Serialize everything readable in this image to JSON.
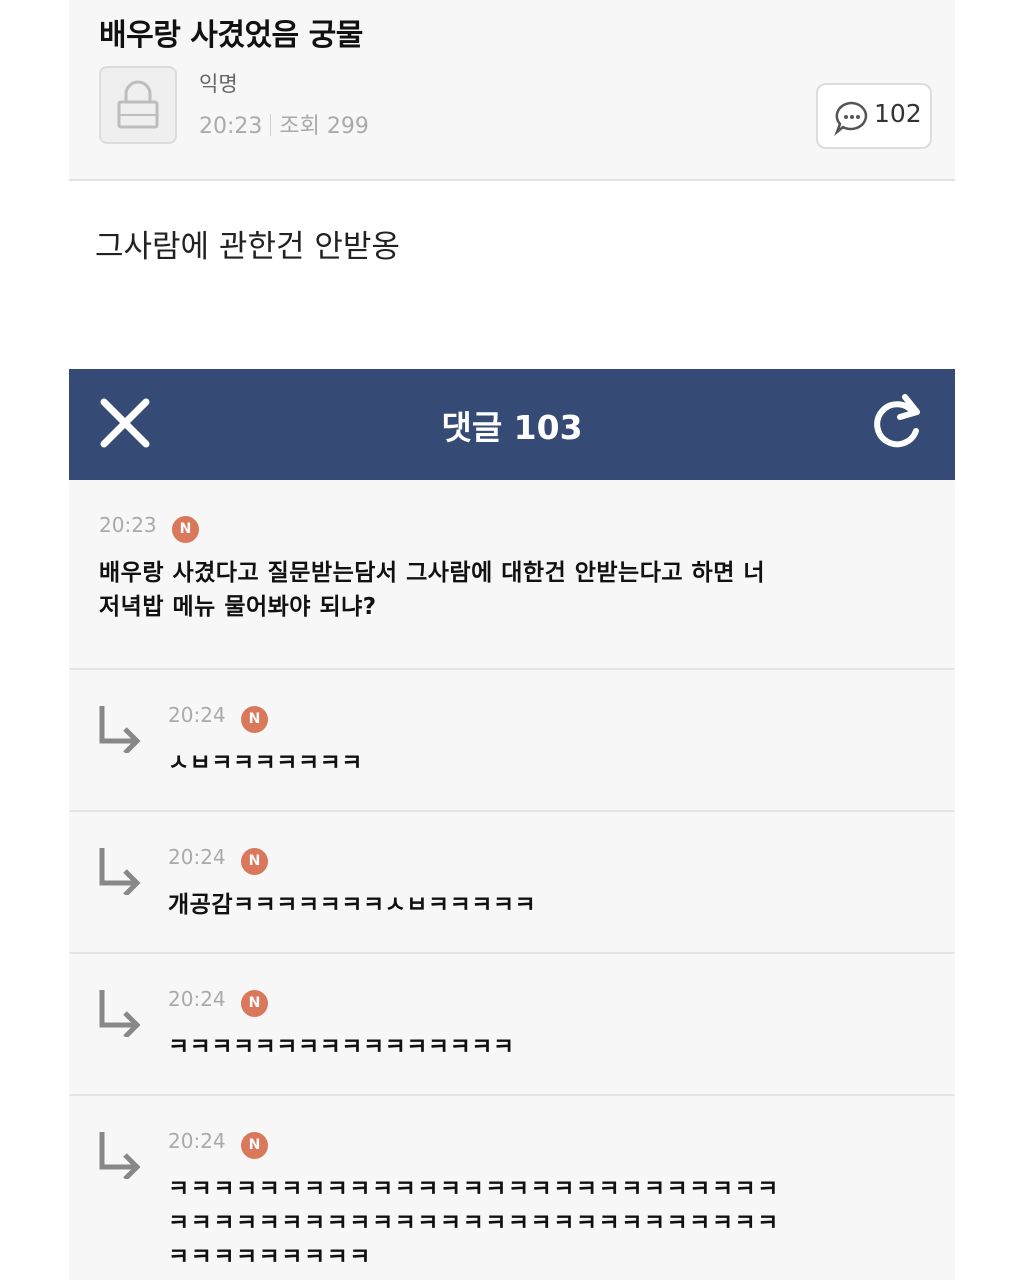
{
  "post": {
    "title": "배우랑 사겼었음 궁물",
    "author": "익명",
    "time": "20:23",
    "views_label": "조회 299",
    "comment_count": "102",
    "body": "그사람에 관한건 안받옹"
  },
  "comments_header": {
    "title": "댓글 103"
  },
  "comments": [
    {
      "time": "20:23",
      "badge": "N",
      "text_line1": "배우랑 사겼다고 질문받는담서 그사람에 대한건 안받는다고 하면 너",
      "text_line2": "저녁밥 메뉴 물어봐야 되냐?"
    },
    {
      "time": "20:24",
      "badge": "N",
      "text": "ㅅㅂㅋㅋㅋㅋㅋㅋㅋ"
    },
    {
      "time": "20:24",
      "badge": "N",
      "text": "개공감ㅋㅋㅋㅋㅋㅋㅋㅅㅂㅋㅋㅋㅋㅋ"
    },
    {
      "time": "20:24",
      "badge": "N",
      "text": "ㅋㅋㅋㅋㅋㅋㅋㅋㅋㅋㅋㅋㅋㅋㅋㅋ"
    },
    {
      "time": "20:24",
      "badge": "N",
      "text_line1": "ㅋㅋㅋㅋㅋㅋㅋㅋㅋㅋㅋㅋㅋㅋㅋㅋㅋㅋㅋㅋㅋㅋㅋㅋㅋㅋㅋ",
      "text_line2": "ㅋㅋㅋㅋㅋㅋㅋㅋㅋㅋㅋㅋㅋㅋㅋㅋㅋㅋㅋㅋㅋㅋㅋㅋㅋㅋㅋ",
      "text_line3": "ㅋㅋㅋㅋㅋㅋㅋㅋㅋ"
    }
  ],
  "icons": {
    "lock": "lock-icon",
    "comment": "speech-bubble-icon",
    "close": "close-icon",
    "refresh": "refresh-icon",
    "reply": "reply-arrow-icon"
  },
  "colors": {
    "header_bar": "#354a75",
    "badge": "#d9785a"
  }
}
